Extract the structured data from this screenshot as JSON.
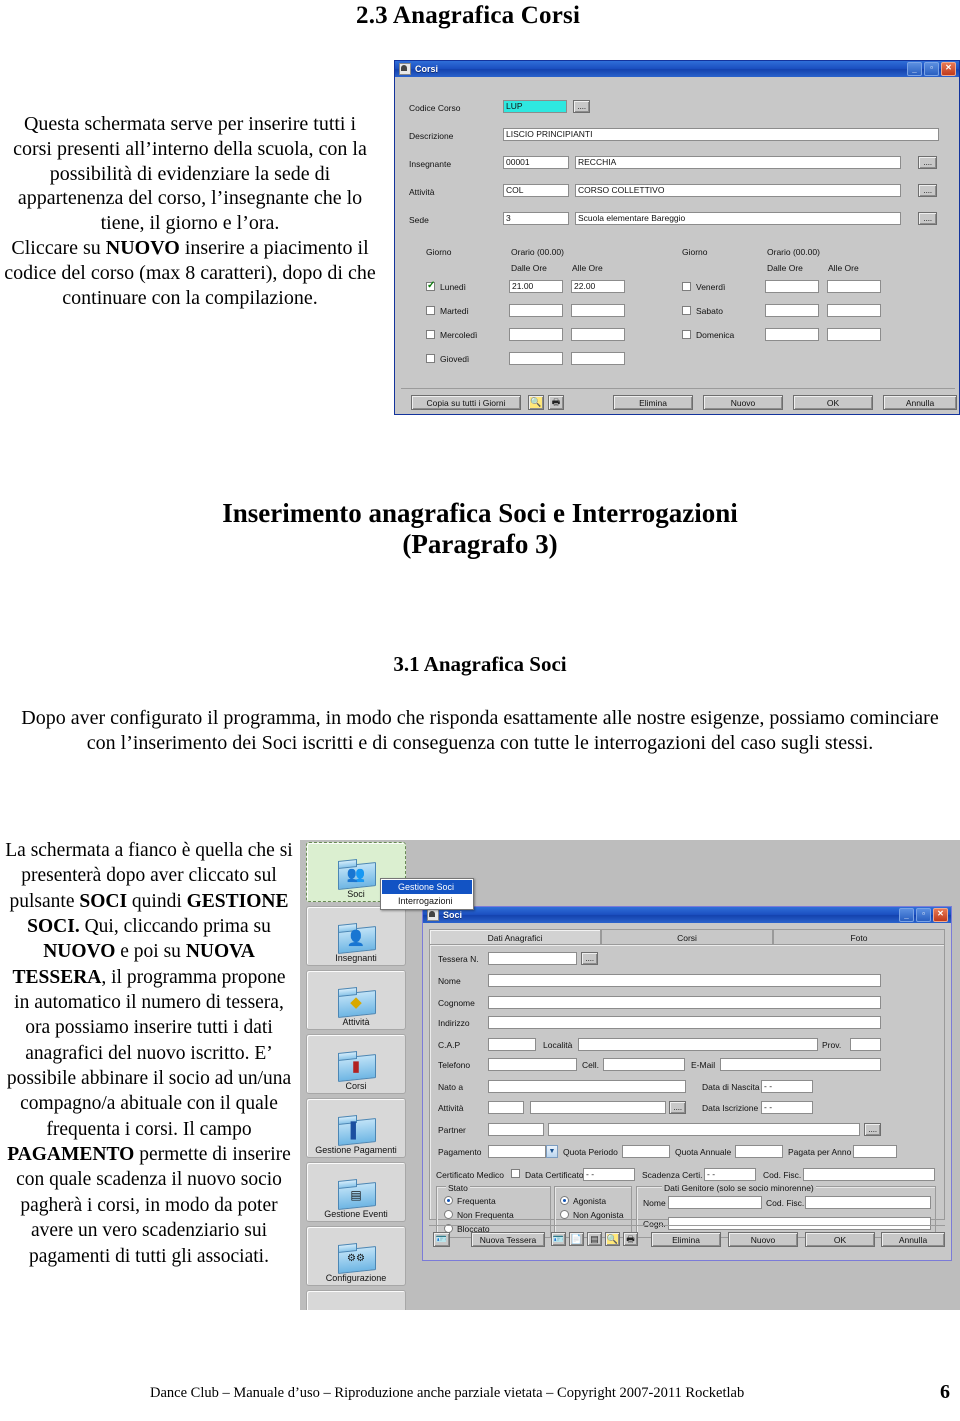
{
  "document": {
    "heading": "2.3 Anagrafica Corsi",
    "intro_paragraph": "Questa schermata serve per inserire tutti i corsi presenti all’interno della scuola, con la possibilità di evidenziare la sede di appartenenza del corso, l’insegnante che lo tiene, il giorno e l’ora.",
    "intro_paragraph_2_pre": "Cliccare su ",
    "intro_paragraph_2_bold": "NUOVO",
    "intro_paragraph_2_post": " inserire a piacimento il codice del corso (max 8 caratteri), dopo di che continuare con la compilazione.",
    "section_title_line1": "Inserimento anagrafica Soci e Interrogazioni",
    "section_title_line2": "(Paragrafo  3)",
    "subsection_title": "3.1 Anagrafica Soci",
    "body_paragraph": "Dopo aver configurato il programma, in modo che risponda esattamente alle nostre esigenze, possiamo cominciare con l’inserimento dei Soci iscritti e di conseguenza con tutte le interrogazioni del caso sugli stessi.",
    "side_paragraph_1": "La schermata a fianco è quella che si presenterà dopo aver cliccato sul pulsante ",
    "side_bold_1": "SOCI",
    "side_paragraph_2": " quindi ",
    "side_bold_2": "GESTIONE SOCI.",
    "side_paragraph_3": " Qui, cliccando prima su ",
    "side_bold_3": "NUOVO",
    "side_paragraph_4": "  e poi su ",
    "side_bold_4": "NUOVA TESSERA",
    "side_paragraph_5": ", il programma propone in automatico il numero di tessera, ora possiamo inserire tutti i dati anagrafici del nuovo iscritto. E’ possibile abbinare il socio ad un/una compagno/a abituale con il quale frequenta i corsi. Il campo ",
    "side_bold_5": "PAGAMENTO",
    "side_paragraph_6": " permette di inserire con quale scadenza il nuovo socio pagherà i corsi, in modo da poter avere un vero scadenziario sui pagamenti di tutti gli associati.",
    "footer_text": "Dance Club – Manuale d’uso – Riproduzione anche parziale vietata – Copyright 2007-2011 Rocketlab",
    "page_number": "6"
  },
  "corsi_window": {
    "title": "Corsi",
    "window_buttons": [
      "minimize-button",
      "maximize-button",
      "close-button"
    ],
    "fields": [
      {
        "label": "Codice Corso",
        "value": "LUP",
        "highlighted": true,
        "has_lookup": true
      },
      {
        "label": "Descrizione",
        "value": "LISCIO PRINCIPIANTI",
        "has_lookup": false
      },
      {
        "label": "Insegnante",
        "code": "00001",
        "value": "RECCHIA",
        "has_lookup": true
      },
      {
        "label": "Attività",
        "code": "COL",
        "value": "CORSO COLLETTIVO",
        "has_lookup": true
      },
      {
        "label": "Sede",
        "code": "3",
        "value": "Scuola elementare Bareggio",
        "has_lookup": true
      }
    ],
    "schedule": {
      "col_header_day": "Giorno",
      "col_header_time": "Orario (00.00)",
      "sub_from": "Dalle Ore",
      "sub_to": "Alle Ore",
      "left_days": [
        {
          "name": "Lunedì",
          "checked": true,
          "from": "21.00",
          "to": "22.00"
        },
        {
          "name": "Martedì",
          "checked": false,
          "from": "",
          "to": ""
        },
        {
          "name": "Mercoledì",
          "checked": false,
          "from": "",
          "to": ""
        },
        {
          "name": "Giovedì",
          "checked": false,
          "from": "",
          "to": ""
        }
      ],
      "right_days": [
        {
          "name": "Venerdì",
          "checked": false,
          "from": "",
          "to": ""
        },
        {
          "name": "Sabato",
          "checked": false,
          "from": "",
          "to": ""
        },
        {
          "name": "Domenica",
          "checked": false,
          "from": "",
          "to": ""
        }
      ]
    },
    "buttons": {
      "copy_all_days": "Copia su tutti i Giorni",
      "preview_icon": "print-preview-icon",
      "print_icon": "printer-icon",
      "delete": "Elimina",
      "new": "Nuovo",
      "ok": "OK",
      "cancel": "Annulla"
    }
  },
  "soci_screen": {
    "sidebar": [
      {
        "label": "Soci",
        "icon": "people-folder-icon",
        "active": true
      },
      {
        "label": "Insegnanti",
        "icon": "person-folder-icon",
        "active": false
      },
      {
        "label": "Attività",
        "icon": "dancer-folder-icon",
        "active": false
      },
      {
        "label": "Corsi",
        "icon": "book-folder-icon",
        "active": false
      },
      {
        "label": "Gestione Pagamenti",
        "icon": "money-folder-icon",
        "active": false
      },
      {
        "label": "Gestione Eventi",
        "icon": "calendar-folder-icon",
        "active": false
      },
      {
        "label": "Configurazione",
        "icon": "gear-folder-icon",
        "active": false
      },
      {
        "label": "",
        "icon": "folder-icon",
        "active": false
      }
    ],
    "context_menu": {
      "items": [
        {
          "label": "Gestione Soci",
          "highlighted": true
        },
        {
          "label": "Interrogazioni",
          "highlighted": false
        }
      ]
    },
    "window": {
      "title": "Soci",
      "tabs": [
        {
          "label": "Dati Anagrafici",
          "selected": true
        },
        {
          "label": "Corsi",
          "selected": false
        },
        {
          "label": "Foto",
          "selected": false
        }
      ],
      "fields": {
        "tessera": "Tessera N.",
        "nome": "Nome",
        "cognome": "Cognome",
        "indirizzo": "Indirizzo",
        "cap": "C.A.P",
        "localita": "Località",
        "prov": "Prov.",
        "telefono": "Telefono",
        "cell": "Cell.",
        "email": "E-Mail",
        "nato_a": "Nato a",
        "data_nascita": "Data di Nascita",
        "attivita": "Attività",
        "data_iscrizione": "Data Iscrizione",
        "partner": "Partner",
        "pagamento": "Pagamento",
        "quota_periodo": "Quota Periodo",
        "quota_annuale": "Quota Annuale",
        "pagata_per_anno": "Pagata per Anno",
        "certificato_medico": "Certificato Medico",
        "data_certificato": "Data Certificato",
        "scadenza_cert": "Scadenza Certi.",
        "cod_fisc": "Cod. Fisc.",
        "date_placeholder": "- -"
      },
      "stato_group": {
        "title": "Stato",
        "options": [
          {
            "label": "Frequenta",
            "selected": true
          },
          {
            "label": "Non Frequenta",
            "selected": false
          },
          {
            "label": "Bloccato",
            "selected": false
          }
        ]
      },
      "agonista_group": {
        "options": [
          {
            "label": "Agonista",
            "selected": true
          },
          {
            "label": "Non Agonista",
            "selected": false
          }
        ]
      },
      "genitore_group": {
        "title": "Dati Genitore (solo se socio minorenne)",
        "nome": "Nome",
        "cod_fisc": "Cod. Fisc.",
        "cogn": "Cogn."
      },
      "buttons": {
        "card_icon": "badge-icon",
        "nuova_tessera": "Nuova Tessera",
        "tool_icons": [
          "badge-print-icon",
          "document-icon",
          "list-icon",
          "search-icon",
          "printer-icon"
        ],
        "delete": "Elimina",
        "new": "Nuovo",
        "ok": "OK",
        "cancel": "Annulla"
      }
    }
  },
  "colors": {
    "titlebar_blue": "#1b4fc0",
    "dialog_gray": "#c8c8c8",
    "highlight_cyan": "#2ee8e0",
    "menu_highlight": "#1253c4",
    "active_sidebar_green": "#dbefd0"
  }
}
